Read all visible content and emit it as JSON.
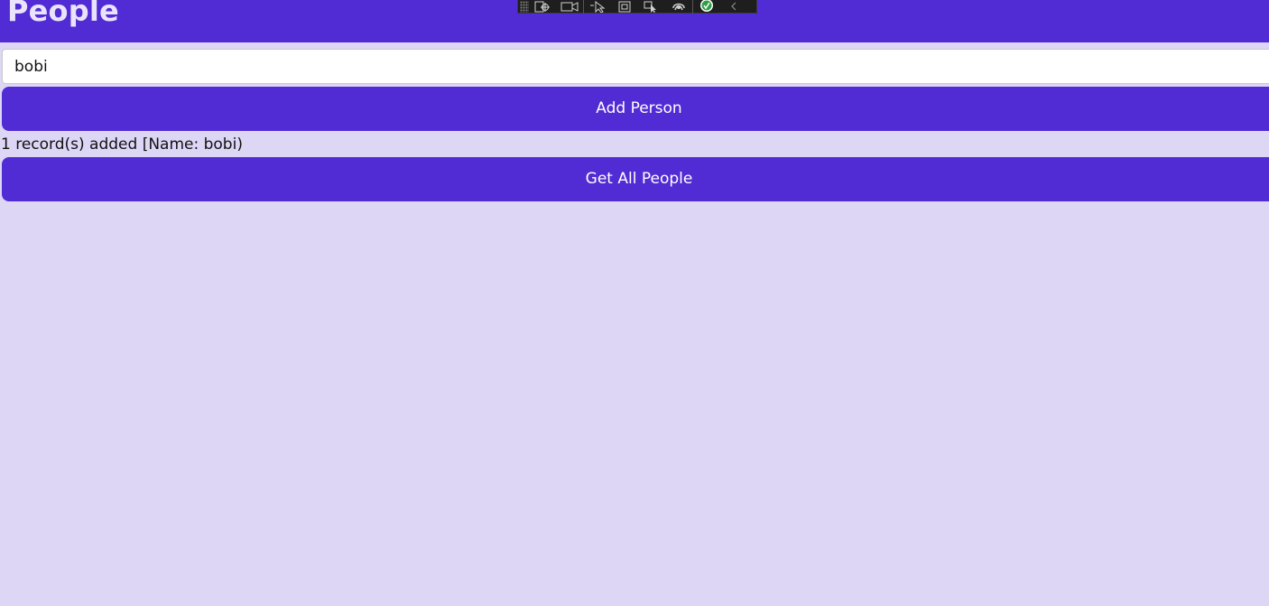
{
  "header": {
    "title": "People",
    "background": "#512bd4"
  },
  "debug_toolbar": {
    "icons": [
      "grip-icon",
      "select-element-icon",
      "record-icon",
      "cursor-icon",
      "frame-icon",
      "pointer-select-icon",
      "hot-reload-icon",
      "check-circle-icon",
      "collapse-chevron-icon"
    ]
  },
  "form": {
    "name_value": "bobi",
    "add_button_label": "Add Person",
    "status_message": "1 record(s) added [Name: bobi)",
    "get_all_button_label": "Get All People"
  },
  "colors": {
    "accent": "#512bd4",
    "page_background": "#ddd6f5",
    "button_text": "#ffffff"
  }
}
